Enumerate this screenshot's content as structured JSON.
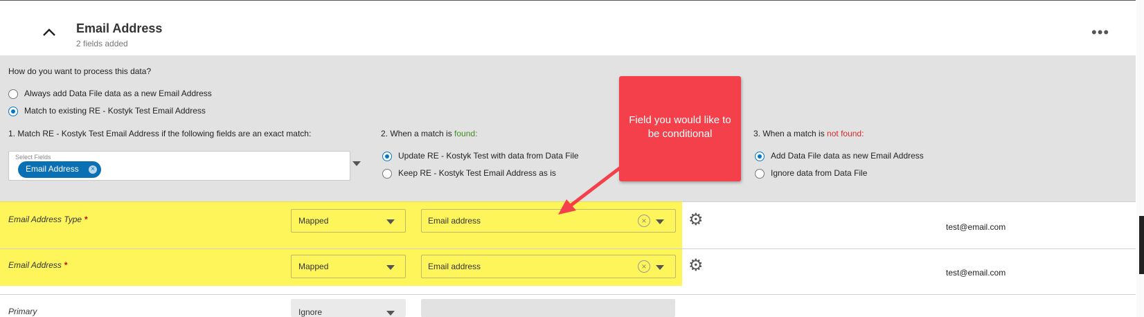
{
  "section": {
    "title": "Email Address",
    "subtitle": "2 fields added",
    "collapse_icon": "chevron-up-icon",
    "more_icon": "more-horizontal-icon"
  },
  "process": {
    "question": "How do you want to process this data?",
    "options": [
      {
        "label": "Always add Data File data as a new Email Address",
        "selected": false
      },
      {
        "label": "Match to existing RE - Kostyk Test Email Address",
        "selected": true
      }
    ]
  },
  "match": {
    "step1_label": "1. Match RE - Kostyk Test Email Address if the following fields are an exact match:",
    "select_label": "Select Fields",
    "chip": "Email Address",
    "step2_prefix": "2. When a match is ",
    "step2_word": "found:",
    "found_options": [
      {
        "label": "Update RE - Kostyk Test with data from Data File",
        "selected": true
      },
      {
        "label": "Keep RE - Kostyk Test Email Address as is",
        "selected": false
      }
    ],
    "step3_prefix": "3. When a match is ",
    "step3_word": "not found:",
    "notfound_options": [
      {
        "label": "Add Data File data as new Email Address",
        "selected": true
      },
      {
        "label": "Ignore data from Data File",
        "selected": false
      }
    ]
  },
  "fields": [
    {
      "name": "Email Address Type",
      "required": true,
      "mode": "Mapped",
      "mapped_to": "Email address",
      "sample": "test@email.com"
    },
    {
      "name": "Email Address",
      "required": true,
      "mode": "Mapped",
      "mapped_to": "Email address",
      "sample": "test@email.com"
    },
    {
      "name": "Primary",
      "required": false,
      "mode": "Ignore",
      "mapped_to": "",
      "sample": ""
    }
  ],
  "annotation": {
    "text": "Field you would like to be conditional",
    "color": "#f4404a",
    "highlight_color": "#fdf55a"
  },
  "colors": {
    "accent": "#0077c8",
    "found": "#3e8e1f",
    "not_found": "#d12b2b"
  }
}
